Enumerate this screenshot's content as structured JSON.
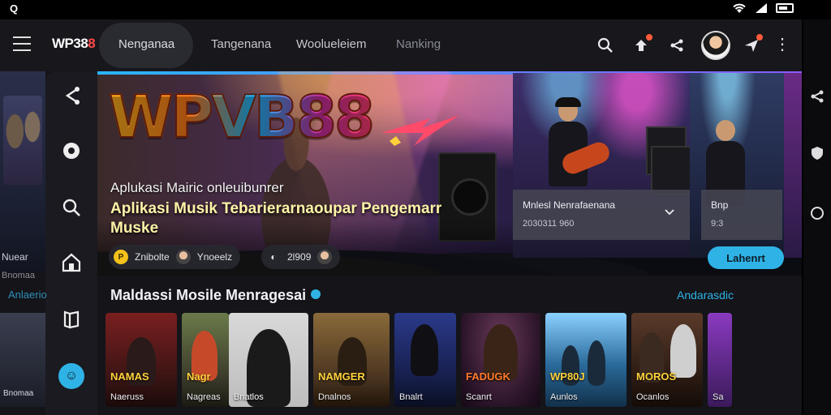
{
  "status_bar": {
    "left_glyph": "Q"
  },
  "app": {
    "logo_text": "WP38",
    "logo_accent": "8",
    "nav_tabs": [
      {
        "label": "Nenganaa",
        "active": true
      },
      {
        "label": "Tangenana",
        "active": false
      },
      {
        "label": "Woolueleiem",
        "active": false
      },
      {
        "label": "Nanking",
        "active": false
      }
    ],
    "accent_color": "#2fb3e6"
  },
  "peek_left": {
    "label": "Nuear",
    "sub": "Bnomaa"
  },
  "hero": {
    "logo": "WPVB88",
    "subtitle": "Aplukasi Mairic onleuibunrer",
    "headline": "Aplikasi Musik Tebarierarnaoupar Pengemarr Muske",
    "pills": [
      {
        "text": "Znibolte"
      },
      {
        "text": "Ynoeelz"
      },
      {
        "text": "2l909"
      }
    ],
    "info_card_1": {
      "title": "Mnlesl Nenrafaenana",
      "meta": "2030311 960"
    },
    "info_card_2": {
      "title": "Bnp",
      "meta": "9:3"
    },
    "cta_label": "Lahenrt"
  },
  "section": {
    "title": "Maldassi Mosile Menragesai",
    "link": "Andarasdic",
    "peek_label": "Anlaerio"
  },
  "cards": [
    {
      "title": "NAMAS",
      "label": "Naeruss",
      "color": "#8a2a2a"
    },
    {
      "title": "Nagr",
      "label": "Nagreas",
      "color": "#5a6a3a"
    },
    {
      "title": "",
      "label": "Bnatlos",
      "color": "#c9c9c9"
    },
    {
      "title": "NAMGER",
      "label": "Dnalnos",
      "color": "#6a4a2a"
    },
    {
      "title": "",
      "label": "Bnalrt",
      "color": "#2a3a7a"
    },
    {
      "title": "FADUGK",
      "label": "Scanrt",
      "color": "#3a1a3a"
    },
    {
      "title": "WP80J",
      "label": "Aunlos",
      "color": "#2a5a7a"
    },
    {
      "title": "MOROS",
      "label": "Ocanlos",
      "color": "#3a2a1a"
    },
    {
      "title": "",
      "label": "Sa",
      "color": "#5a2a7a"
    }
  ],
  "left_card_peek": {
    "label": "Bnomaa"
  },
  "icons": {
    "search": "search-icon",
    "share": "share-icon",
    "notifications": "bell-icon",
    "more": "more-vertical-icon"
  }
}
